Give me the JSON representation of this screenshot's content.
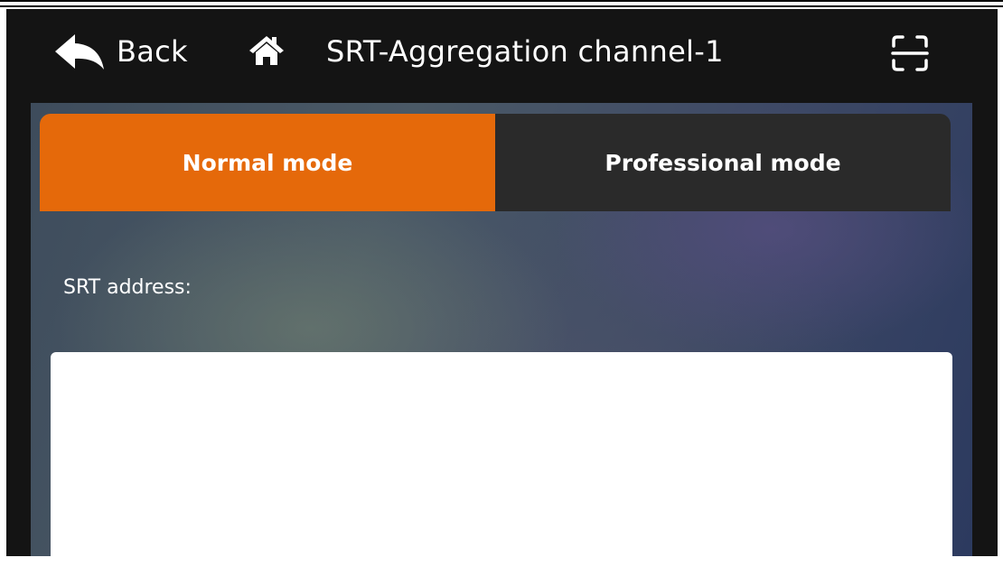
{
  "header": {
    "back_label": "Back",
    "title": "SRT-Aggregation channel-1",
    "back_icon": "back-arrow-icon",
    "home_icon": "home-icon",
    "scan_icon": "scan-icon"
  },
  "tabs": [
    {
      "label": "Normal mode",
      "active": true
    },
    {
      "label": "Professional mode",
      "active": false
    }
  ],
  "form": {
    "srt_address_label": "SRT address:",
    "srt_address_value": "",
    "srt_address_placeholder": ""
  },
  "colors": {
    "accent": "#e5690a",
    "tab_inactive": "#2a2a2a",
    "header_bg": "#141414"
  }
}
